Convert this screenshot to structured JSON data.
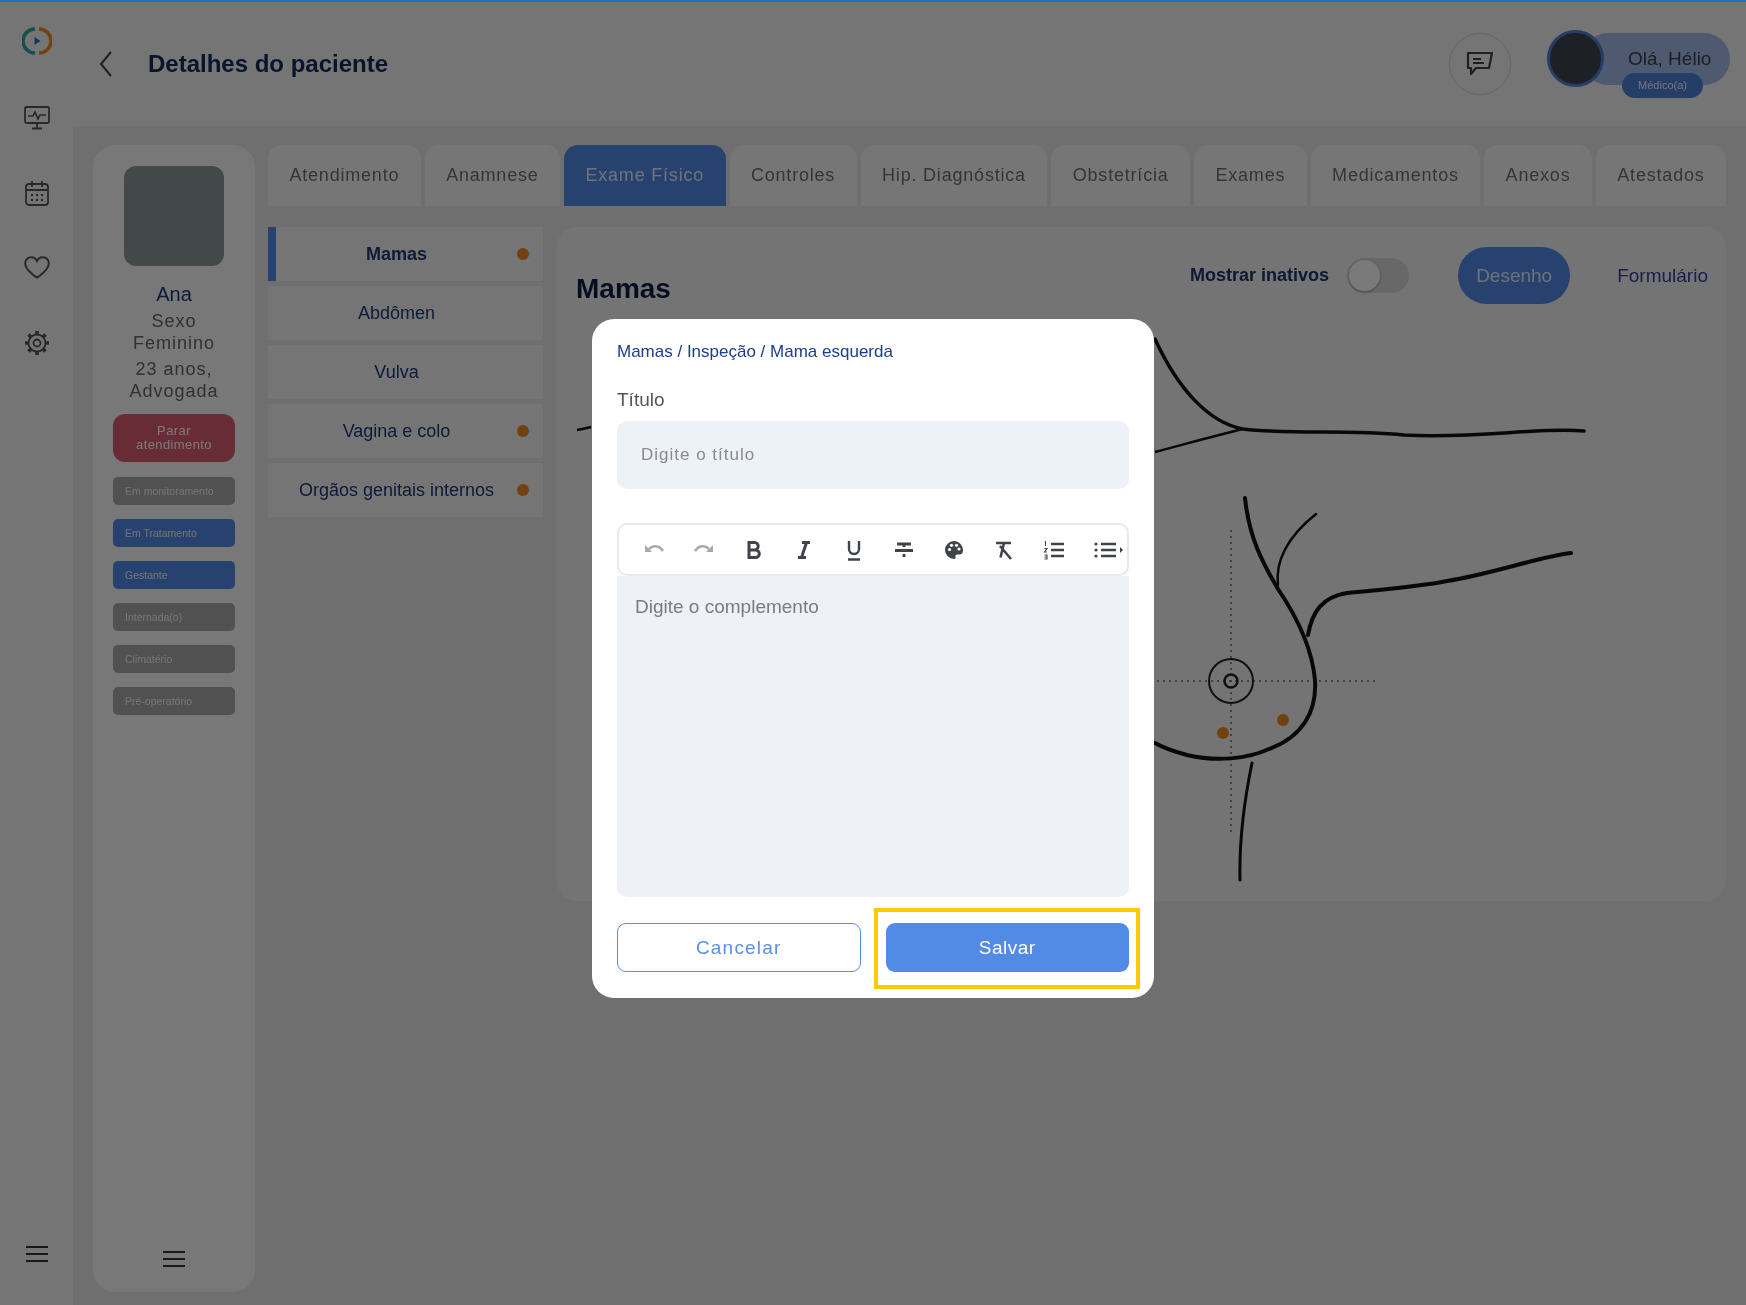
{
  "header": {
    "title": "Detalhes do paciente",
    "user": {
      "greeting": "Olá, Hélio",
      "role": "Médico(a)"
    }
  },
  "patient": {
    "name": "Ana",
    "sex": "Sexo Feminino",
    "age_occupation": "23 anos, Advogada",
    "stop_button": "Parar atendimento",
    "tags": [
      {
        "label": "Em monitoramento",
        "active": false
      },
      {
        "label": "Em Tratamento",
        "active": true
      },
      {
        "label": "Gestante",
        "active": true
      },
      {
        "label": "Internada(o)",
        "active": false
      },
      {
        "label": "Climatério",
        "active": false
      },
      {
        "label": "Pré-operatório",
        "active": false
      }
    ]
  },
  "tabs": [
    {
      "label": "Atendimento",
      "selected": false
    },
    {
      "label": "Anamnese",
      "selected": false
    },
    {
      "label": "Exame Físico",
      "selected": true
    },
    {
      "label": "Controles",
      "selected": false
    },
    {
      "label": "Hip. Diagnóstica",
      "selected": false
    },
    {
      "label": "Obstetrícia",
      "selected": false
    },
    {
      "label": "Exames",
      "selected": false
    },
    {
      "label": "Medicamentos",
      "selected": false
    },
    {
      "label": "Anexos",
      "selected": false
    },
    {
      "label": "Atestados",
      "selected": false
    }
  ],
  "sections": [
    {
      "label": "Mamas",
      "selected": true,
      "flagged": true
    },
    {
      "label": "Abdômen",
      "selected": false,
      "flagged": false
    },
    {
      "label": "Vulva",
      "selected": false,
      "flagged": false
    },
    {
      "label": "Vagina e colo",
      "selected": false,
      "flagged": true
    },
    {
      "label": "Orgãos genitais internos",
      "selected": false,
      "flagged": true
    }
  ],
  "panel": {
    "title": "Mamas",
    "show_inactive": {
      "label": "Mostrar inativos",
      "on": false
    },
    "view_modes": [
      {
        "label": "Desenho",
        "selected": true
      },
      {
        "label": "Formulário",
        "selected": false
      }
    ]
  },
  "modal": {
    "breadcrumb": "Mamas / Inspeção / Mama esquerda",
    "title_label": "Título",
    "title_field": {
      "placeholder": "Digite o título"
    },
    "toolbar": [
      {
        "kind": "undo",
        "disabled": true
      },
      {
        "kind": "redo",
        "disabled": true
      },
      {
        "kind": "bold",
        "disabled": false
      },
      {
        "kind": "italic",
        "disabled": false
      },
      {
        "kind": "underline",
        "disabled": false
      },
      {
        "kind": "strike",
        "disabled": false
      },
      {
        "kind": "color",
        "disabled": false
      },
      {
        "kind": "clean",
        "disabled": false
      },
      {
        "kind": "ordered_list",
        "disabled": false
      },
      {
        "kind": "bullet_list",
        "disabled": false
      }
    ],
    "editor": {
      "placeholder": "Digite o complemento"
    },
    "buttons": [
      {
        "label": "Cancelar",
        "kind": "secondary",
        "highlighted": false
      },
      {
        "label": "Salvar",
        "kind": "primary",
        "highlighted": true
      }
    ]
  }
}
